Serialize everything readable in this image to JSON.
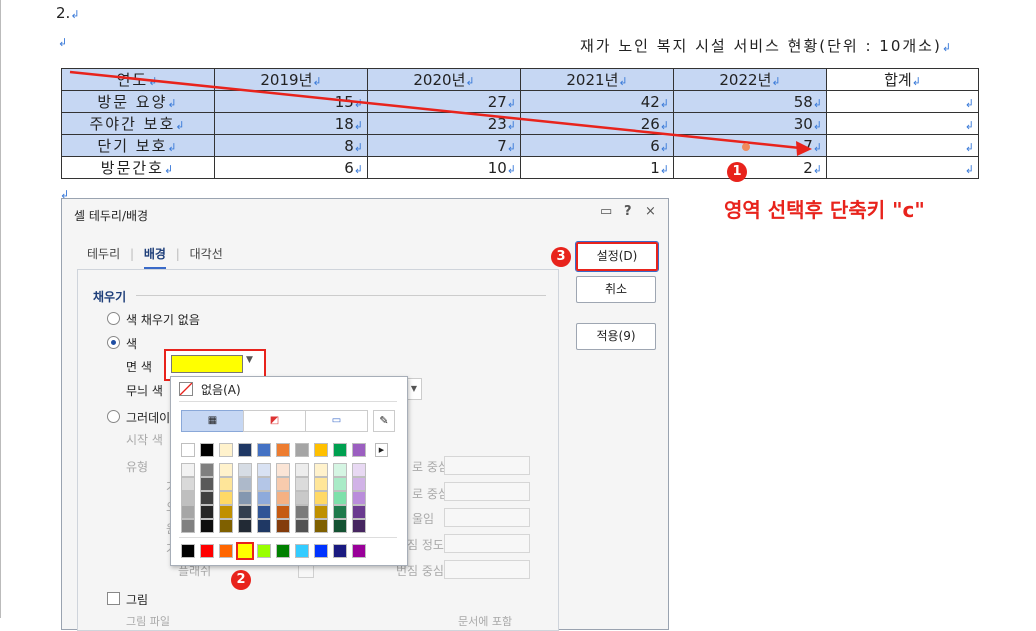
{
  "document": {
    "para_number": "2.",
    "table_title": "재가 노인 복지 시설 서비스 현황(단위 : 10개소)",
    "header": [
      "연도",
      "2019년",
      "2020년",
      "2021년",
      "2022년",
      "합계"
    ],
    "rows": [
      {
        "label": "방문 요양",
        "values": [
          "15",
          "27",
          "42",
          "58"
        ]
      },
      {
        "label": "주야간 보호",
        "values": [
          "18",
          "23",
          "26",
          "30"
        ]
      },
      {
        "label": "단기 보호",
        "values": [
          "8",
          "7",
          "6",
          "7"
        ]
      },
      {
        "label": "방문간호",
        "values": [
          "6",
          "10",
          "1",
          "2"
        ]
      }
    ]
  },
  "annotations": {
    "note_text": "영역 선택후 단축키 \"c\"",
    "badge1": "1",
    "badge2": "2",
    "badge3": "3",
    "accent_color": "#e8231c"
  },
  "dialog": {
    "title": "셀 테두리/배경",
    "help_icon": "?",
    "close_icon": "×",
    "tabs": [
      "테두리",
      "배경",
      "대각선"
    ],
    "active_tab": "배경",
    "buttons": {
      "ok": "설정(D)",
      "cancel": "취소",
      "apply": "적용(9)"
    },
    "fill_group": "채우기",
    "options": {
      "no_fill": "색 채우기 없음",
      "color": "색",
      "face_color_label": "면 색",
      "face_color_value": "#ffff00",
      "pattern_color_label": "무늬 색",
      "gradient": "그러데이",
      "start_color": "시작 색",
      "type_label": "유형",
      "center_label_1": "로 중심",
      "center_label_2": "로 중심",
      "slope_label": "울임",
      "blur_label": "번짐 정도",
      "blur_center_label": "번짐 중심",
      "gradient_left_1": "가",
      "gradient_left_2": "오",
      "gradient_left_3": "원",
      "gradient_left_4": "가",
      "spread_label": "플래쉬",
      "picture": "그림",
      "picture_file": "그림 파일",
      "include_doc": "문서에 포함"
    }
  },
  "palette": {
    "none_label": "없음(A)",
    "top_row": [
      "#ffffff",
      "#000000",
      "#fff2cc",
      "#1f3864",
      "#4472c4",
      "#ed7d31",
      "#a5a5a5",
      "#ffc000",
      "#00a050",
      "#9b5fc0"
    ],
    "grid_columns": [
      [
        "#f2f2f2",
        "#d9d9d9",
        "#bfbfbf",
        "#a6a6a6",
        "#808080"
      ],
      [
        "#7f7f7f",
        "#595959",
        "#404040",
        "#262626",
        "#0d0d0d"
      ],
      [
        "#fff2cc",
        "#fee599",
        "#fed966",
        "#c09000",
        "#7f6000"
      ],
      [
        "#d6dce4",
        "#adb9ca",
        "#8497b0",
        "#333f4f",
        "#222a35"
      ],
      [
        "#d9e2f3",
        "#b4c6e7",
        "#8eaadb",
        "#2f5496",
        "#1f3864"
      ],
      [
        "#fbe5d6",
        "#f8cbad",
        "#f4b183",
        "#c55a11",
        "#843c0c"
      ],
      [
        "#ededed",
        "#dbdbdb",
        "#c9c9c9",
        "#7b7b7b",
        "#525252"
      ],
      [
        "#fff2cc",
        "#ffe699",
        "#ffd966",
        "#bf9000",
        "#7f6000"
      ],
      [
        "#d5f5e3",
        "#a9ebc7",
        "#7ee0ab",
        "#1f7a4c",
        "#145232"
      ],
      [
        "#e8d9f3",
        "#d1b3e7",
        "#ba8ddb",
        "#6a3a8f",
        "#462660"
      ]
    ],
    "standard_row": [
      "#000000",
      "#ff0000",
      "#ff6600",
      "#ffff00",
      "#99ff00",
      "#008000",
      "#33ccff",
      "#0033ff",
      "#1a1a80",
      "#990099"
    ],
    "selected": "#ffff00"
  }
}
